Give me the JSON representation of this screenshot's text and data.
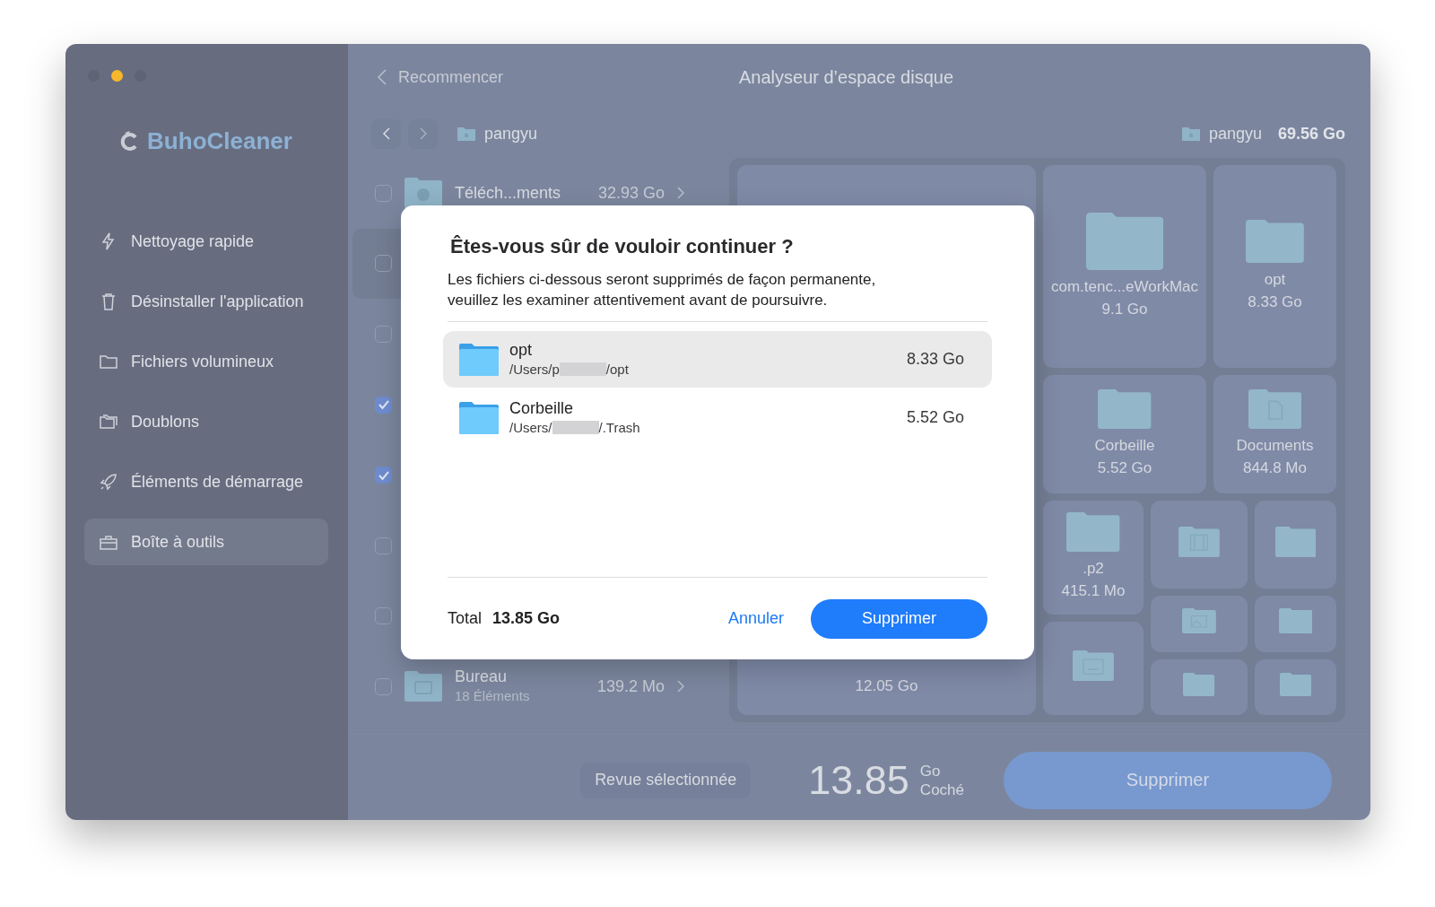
{
  "window": {
    "traffic_lights": [
      {
        "color": "#5e6474"
      },
      {
        "color": "#f6b82a"
      },
      {
        "color": "#5e6474"
      }
    ]
  },
  "sidebar": {
    "logo": "BuhoCleaner",
    "items": [
      {
        "label": "Nettoyage rapide",
        "kind": "bolt",
        "selected": false
      },
      {
        "label": "Désinstaller l'application",
        "kind": "trash",
        "selected": false
      },
      {
        "label": "Fichiers volumineux",
        "kind": "folder",
        "selected": false
      },
      {
        "label": "Doublons",
        "kind": "duplicate",
        "selected": false
      },
      {
        "label": "Éléments de démarrage",
        "kind": "rocket",
        "selected": false
      },
      {
        "label": "Boîte à outils",
        "kind": "toolbox",
        "selected": true
      }
    ]
  },
  "header": {
    "back": "Recommencer",
    "title": "Analyseur d’espace disque"
  },
  "path_bar": {
    "folder": "pangyu",
    "summary_folder": "pangyu",
    "summary_size": "69.56 Go"
  },
  "file_list": [
    {
      "name": "Téléch...ments",
      "size": "32.93 Go",
      "kind": "download",
      "checked": false,
      "selected": false
    },
    {
      "checked": false,
      "selected": true
    },
    {
      "checked": false,
      "selected": false
    },
    {
      "checked": true,
      "selected": false
    },
    {
      "checked": true,
      "selected": false
    },
    {
      "checked": false,
      "selected": false
    },
    {
      "checked": false,
      "selected": false
    },
    {
      "name": "Bureau",
      "count": "18 Éléments",
      "size": "139.2 Mo",
      "kind": "app",
      "checked": false,
      "selected": false
    }
  ],
  "treemap": [
    {
      "size": "12.05 Go",
      "kind": "hidden"
    },
    {
      "name": "com.tenc...eWorkMac",
      "size": "9.1 Go",
      "kind": "folder"
    },
    {
      "name": "opt",
      "size": "8.33 Go",
      "kind": "folder"
    },
    {
      "name": "Corbeille",
      "size": "5.52 Go",
      "kind": "folder"
    },
    {
      "name": "Documents",
      "size": "844.8 Mo",
      "kind": "document"
    },
    {
      "name": ".p2",
      "size": "415.1 Mo",
      "kind": "folder"
    },
    {
      "kind": "film"
    },
    {
      "kind": "folder"
    },
    {
      "kind": "app"
    },
    {
      "kind": "image"
    },
    {
      "kind": "folder"
    },
    {
      "kind": "folder"
    },
    {
      "kind": "folder"
    }
  ],
  "footer": {
    "review_button": "Revue sélectionnée",
    "checked_total": "13.85",
    "unit": "Go",
    "unit_label": "Coché",
    "delete_button": "Supprimer"
  },
  "dialog": {
    "title": "Êtes-vous sûr de vouloir continuer ?",
    "message": "Les fichiers ci-dessous seront supprimés de façon permanente,\nveuillez les examiner attentivement avant de poursuivre.",
    "items": [
      {
        "name": "opt",
        "path_start": "/Users/p",
        "path_end": "/opt",
        "size": "8.33 Go",
        "selected": true
      },
      {
        "name": "Corbeille",
        "path_start": "/Users/",
        "path_end": "/.Trash",
        "size": "5.52 Go",
        "selected": false
      }
    ],
    "total_label": "Total",
    "total": "13.85 Go",
    "cancel": "Annuler",
    "confirm": "Supprimer"
  }
}
